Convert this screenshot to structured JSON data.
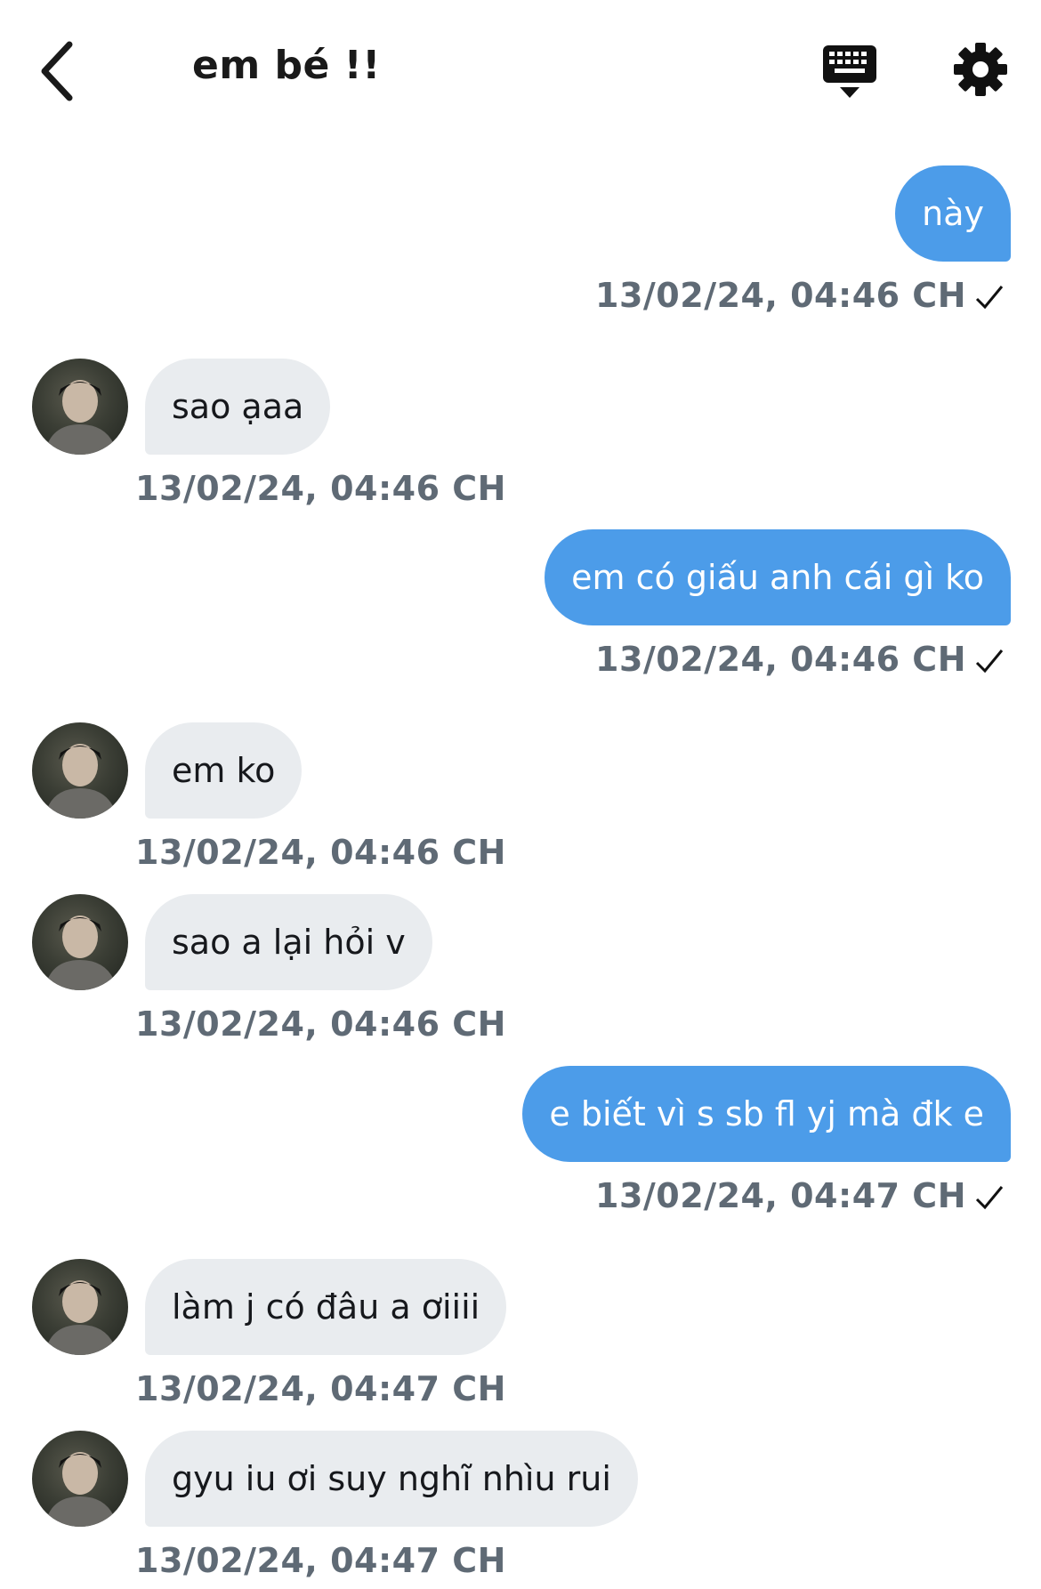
{
  "header": {
    "title": "em bé !!",
    "back_icon": "chevron-left-icon",
    "keyboard_icon": "keyboard-icon",
    "settings_icon": "gear-icon"
  },
  "colors": {
    "outgoing_bubble": "#4c9ce9",
    "incoming_bubble": "#e9ecef",
    "timestamp": "#5f6a75"
  },
  "messages": [
    {
      "direction": "out",
      "text": "này",
      "time": "13/02/24, 04:46 CH"
    },
    {
      "direction": "in",
      "text": "sao ạaa",
      "time": "13/02/24, 04:46 CH"
    },
    {
      "direction": "out",
      "text": "em có giấu anh cái gì ko",
      "time": "13/02/24, 04:46 CH"
    },
    {
      "direction": "in",
      "text": "em ko",
      "time": "13/02/24, 04:46 CH"
    },
    {
      "direction": "in",
      "text": "sao a lại hỏi v",
      "time": "13/02/24, 04:46 CH"
    },
    {
      "direction": "out",
      "text": "e biết vì s sb fl yj mà đk e",
      "time": "13/02/24, 04:47 CH"
    },
    {
      "direction": "in",
      "text": "làm j có đâu a ơiiii",
      "time": "13/02/24, 04:47 CH"
    },
    {
      "direction": "in",
      "text": "gyu iu ơi suy nghĩ nhìu rui",
      "time": "13/02/24, 04:47 CH"
    }
  ]
}
